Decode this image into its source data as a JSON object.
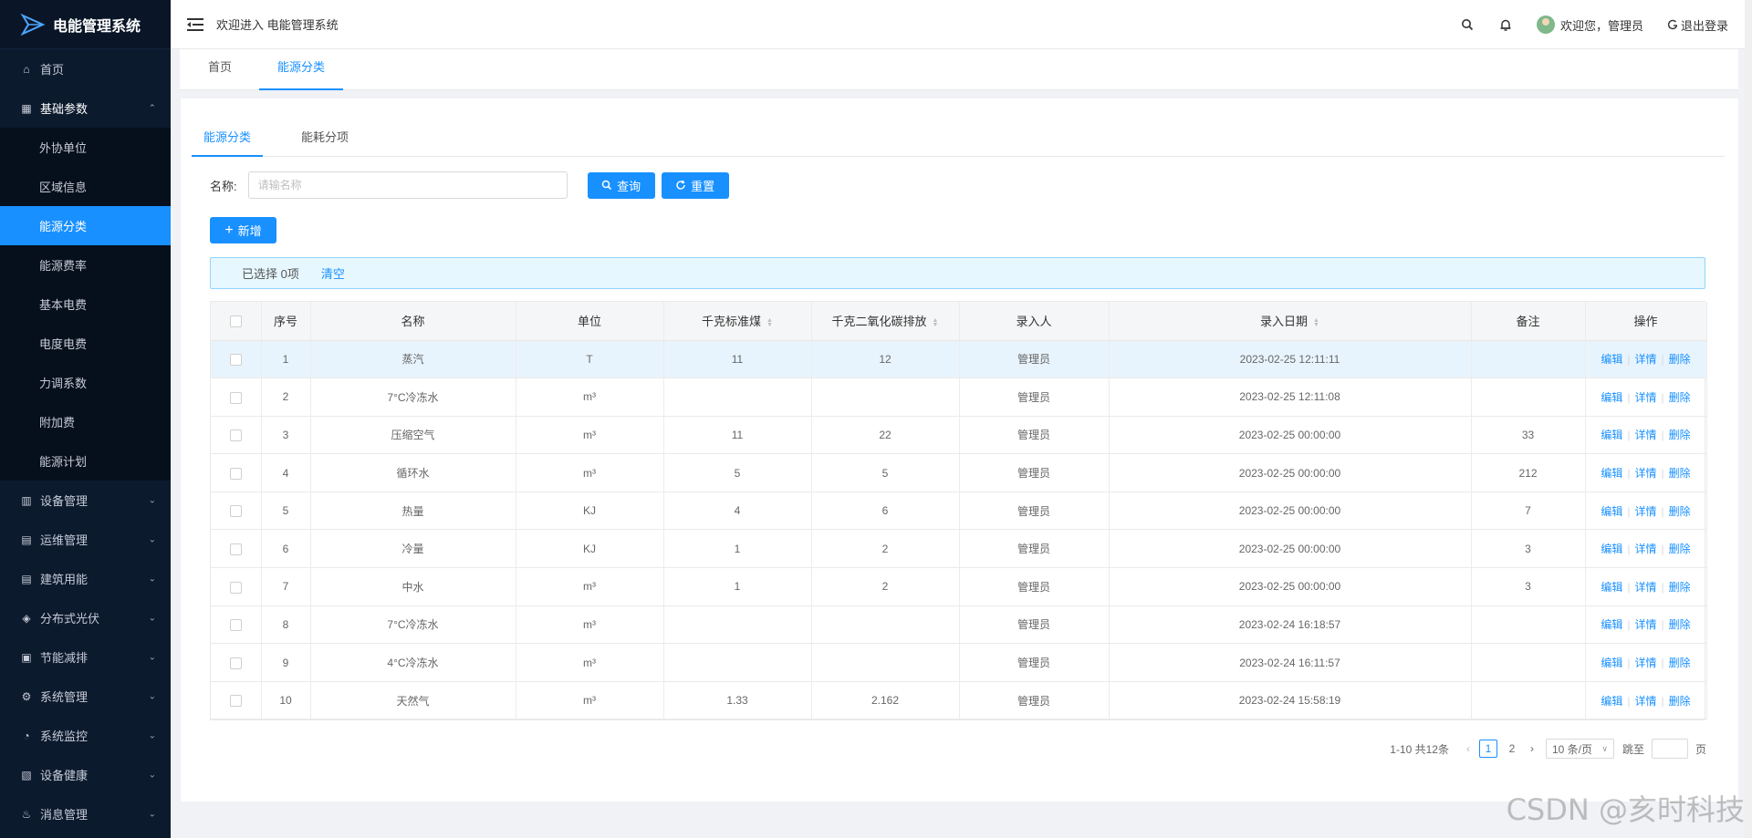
{
  "app": {
    "title": "电能管理系统"
  },
  "sidebar": {
    "items": [
      {
        "label": "首页",
        "icon": "home-icon"
      },
      {
        "label": "基础参数",
        "icon": "grid-icon",
        "open": true,
        "children": [
          "外协单位",
          "区域信息",
          "能源分类",
          "能源费率",
          "基本电费",
          "电度电费",
          "力调系数",
          "附加费",
          "能源计划"
        ],
        "active_child": "能源分类"
      },
      {
        "label": "设备管理",
        "icon": "building-icon"
      },
      {
        "label": "运维管理",
        "icon": "clipboard-icon"
      },
      {
        "label": "建筑用能",
        "icon": "clipboard-icon"
      },
      {
        "label": "分布式光伏",
        "icon": "solar-icon"
      },
      {
        "label": "节能减排",
        "icon": "calendar-icon"
      },
      {
        "label": "系统管理",
        "icon": "gear-icon"
      },
      {
        "label": "系统监控",
        "icon": "monitor-icon"
      },
      {
        "label": "设备健康",
        "icon": "heart-icon"
      },
      {
        "label": "消息管理",
        "icon": "message-icon"
      }
    ]
  },
  "header": {
    "welcome": "欢迎进入 电能管理系统",
    "user_greeting": "欢迎您，管理员",
    "logout": "退出登录"
  },
  "page_tabs": [
    {
      "label": "首页",
      "active": false
    },
    {
      "label": "能源分类",
      "active": true
    }
  ],
  "sub_tabs": [
    {
      "label": "能源分类",
      "active": true
    },
    {
      "label": "能耗分项",
      "active": false
    }
  ],
  "search": {
    "label": "名称:",
    "placeholder": "请输名称",
    "query_button": "查询",
    "reset_button": "重置"
  },
  "add_button": "新增",
  "selection": {
    "text": "已选择 0项",
    "clear": "清空"
  },
  "table": {
    "columns": [
      "序号",
      "名称",
      "单位",
      "千克标准煤",
      "千克二氧化碳排放",
      "录入人",
      "录入日期",
      "备注",
      "操作"
    ],
    "sortable": [
      "千克标准煤",
      "千克二氧化碳排放",
      "录入日期"
    ],
    "rows": [
      {
        "no": "1",
        "name": "蒸汽",
        "unit": "T",
        "coal": "11",
        "co2": "12",
        "user": "管理员",
        "date": "2023-02-25 12:11:11",
        "note": ""
      },
      {
        "no": "2",
        "name": "7°C冷冻水",
        "unit": "m³",
        "coal": "",
        "co2": "",
        "user": "管理员",
        "date": "2023-02-25 12:11:08",
        "note": ""
      },
      {
        "no": "3",
        "name": "压缩空气",
        "unit": "m³",
        "coal": "11",
        "co2": "22",
        "user": "管理员",
        "date": "2023-02-25 00:00:00",
        "note": "33"
      },
      {
        "no": "4",
        "name": "循环水",
        "unit": "m³",
        "coal": "5",
        "co2": "5",
        "user": "管理员",
        "date": "2023-02-25 00:00:00",
        "note": "212"
      },
      {
        "no": "5",
        "name": "热量",
        "unit": "KJ",
        "coal": "4",
        "co2": "6",
        "user": "管理员",
        "date": "2023-02-25 00:00:00",
        "note": "7"
      },
      {
        "no": "6",
        "name": "冷量",
        "unit": "KJ",
        "coal": "1",
        "co2": "2",
        "user": "管理员",
        "date": "2023-02-25 00:00:00",
        "note": "3"
      },
      {
        "no": "7",
        "name": "中水",
        "unit": "m³",
        "coal": "1",
        "co2": "2",
        "user": "管理员",
        "date": "2023-02-25 00:00:00",
        "note": "3"
      },
      {
        "no": "8",
        "name": "7°C冷冻水",
        "unit": "m³",
        "coal": "",
        "co2": "",
        "user": "管理员",
        "date": "2023-02-24 16:18:57",
        "note": ""
      },
      {
        "no": "9",
        "name": "4°C冷冻水",
        "unit": "m³",
        "coal": "",
        "co2": "",
        "user": "管理员",
        "date": "2023-02-24 16:11:57",
        "note": ""
      },
      {
        "no": "10",
        "name": "天然气",
        "unit": "m³",
        "coal": "1.33",
        "co2": "2.162",
        "user": "管理员",
        "date": "2023-02-24 15:58:19",
        "note": ""
      }
    ],
    "actions": [
      "编辑",
      "详情",
      "删除"
    ]
  },
  "pagination": {
    "total": "1-10 共12条",
    "pages": [
      "1",
      "2"
    ],
    "current": "1",
    "page_size": "10 条/页",
    "jump_label": "跳至",
    "jump_suffix": "页"
  },
  "watermark": "CSDN @亥时科技",
  "colors": {
    "primary": "#1890ff",
    "sidebar_bg": "#0c1a2e",
    "highlight_row": "#e8f4fd"
  }
}
